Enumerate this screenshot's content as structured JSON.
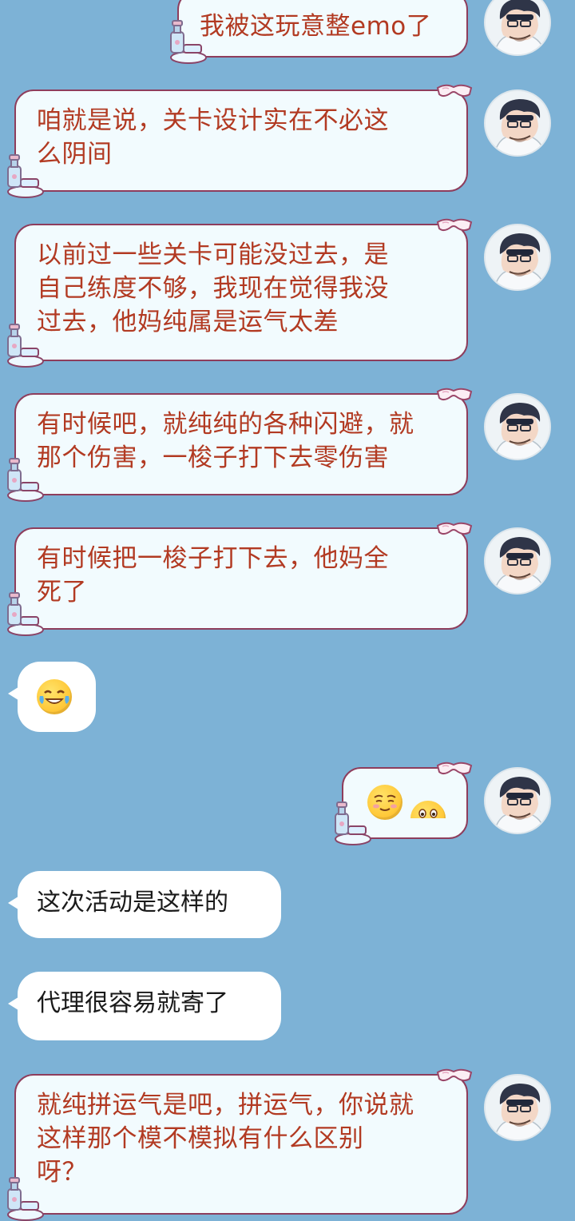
{
  "messages": [
    {
      "side": "me",
      "text": "我被这玩意整emo了"
    },
    {
      "side": "me",
      "lines": [
        "咱就是说，关卡设计实在不必这",
        "么阴间"
      ]
    },
    {
      "side": "me",
      "lines": [
        "以前过一些关卡可能没过去，是",
        "自己练度不够，我现在觉得我没",
        "过去，他妈纯属是运气太差"
      ]
    },
    {
      "side": "me",
      "lines": [
        "有时候吧，就纯纯的各种闪避，就",
        "那个伤害，一梭子打下去零伤害"
      ]
    },
    {
      "side": "me",
      "lines": [
        "有时候把一梭子打下去，他妈全",
        "死了"
      ]
    },
    {
      "side": "other",
      "emoji": "tears-of-joy-emoji"
    },
    {
      "side": "me",
      "emoji": [
        "shy-smile-emoji",
        "peeking-emoji"
      ]
    },
    {
      "side": "other",
      "text": "这次活动是这样的"
    },
    {
      "side": "other",
      "text": "代理很容易就寄了"
    },
    {
      "side": "me",
      "lines": [
        "就纯拼运气是吧，拼运气，你说就",
        "这样那个模不模拟有什么区别",
        "呀？"
      ]
    }
  ],
  "colors": {
    "background": "#7db2d6",
    "my_bubble_bg": "#f2fbfe",
    "my_bubble_border": "#8e3d5c",
    "my_text": "#b23a22",
    "other_bubble_bg": "#ffffff",
    "other_text": "#1a1a1a"
  },
  "icons": {
    "avatar": "avatar-icon",
    "bubble_decor_top": "goggles-icon",
    "bubble_decor_bottom": "potion-bottle-icon"
  }
}
